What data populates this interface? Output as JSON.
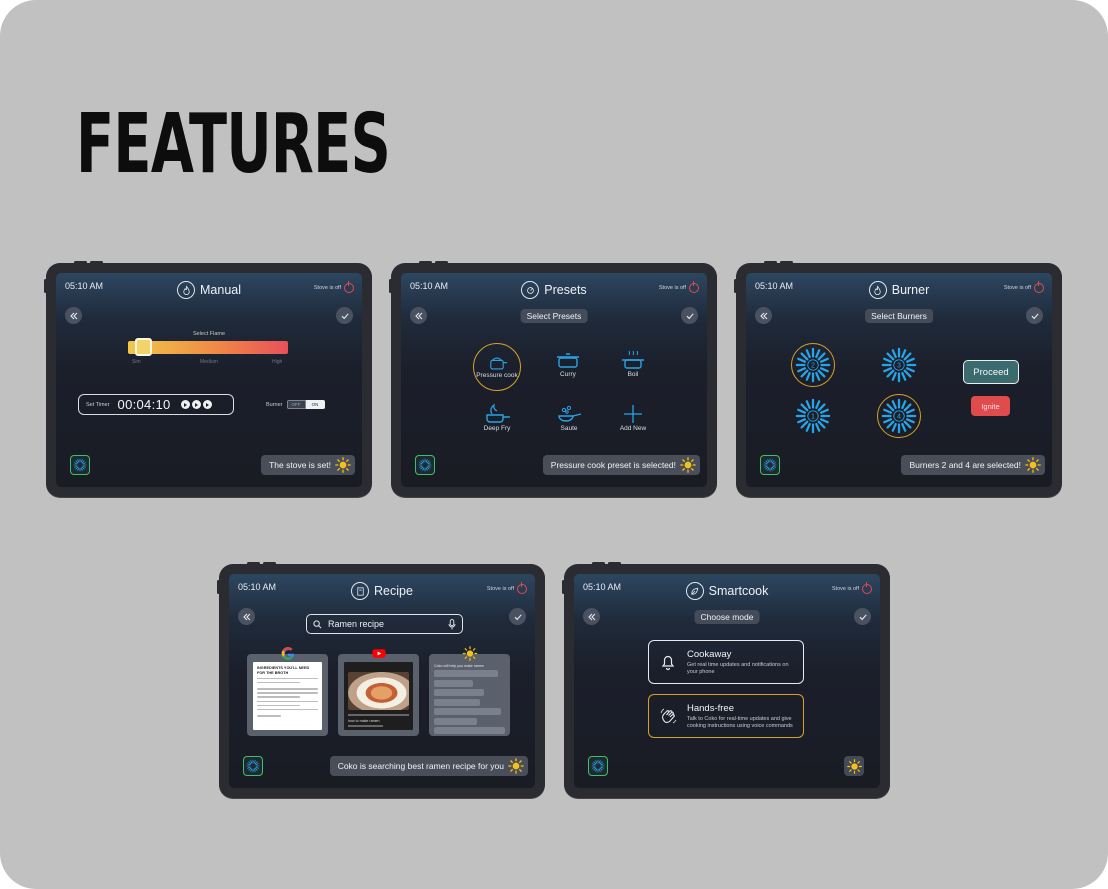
{
  "page": {
    "headline": "FEATURES"
  },
  "colors": {
    "background": "#c1c1c1",
    "accent_gold": "#d6a12b",
    "power_red": "#e14a4a",
    "burner_blue": "#2aa3e6",
    "chip_green": "#3fbf6a",
    "proceed_teal": "#3b6b6e",
    "ignite_red": "#e04b4b"
  },
  "common": {
    "time": "05:10 AM",
    "stove_status": "Stove is off"
  },
  "manual": {
    "title": "Manual",
    "select_flame": "Select Flame",
    "flame_level": 0.05,
    "scale": [
      "Sim",
      "Medium",
      "High"
    ],
    "timer_label": "Set Timer",
    "timer_value": "00:04:10",
    "burner_label": "Burner",
    "toggle_off": "OFF",
    "toggle_on": "ON",
    "toast": "The stove is set!"
  },
  "presets": {
    "title": "Presets",
    "pill": "Select Presets",
    "items": [
      {
        "label": "Pressure cook",
        "icon": "pressure-cooker-icon",
        "selected": true
      },
      {
        "label": "Curry",
        "icon": "pot-icon"
      },
      {
        "label": "Boil",
        "icon": "boiling-pot-icon"
      },
      {
        "label": "Deep Fry",
        "icon": "deep-fry-icon"
      },
      {
        "label": "Saute",
        "icon": "saute-pan-icon"
      },
      {
        "label": "Add New",
        "icon": "plus-icon"
      }
    ],
    "toast": "Pressure cook preset is selected!"
  },
  "burner": {
    "title": "Burner",
    "pill": "Select Burners",
    "burners": [
      {
        "number": "2",
        "selected": true
      },
      {
        "number": "3",
        "selected": false
      },
      {
        "number": "1",
        "selected": false
      },
      {
        "number": "4",
        "selected": true
      }
    ],
    "proceed": "Proceed",
    "ignite": "Ignite",
    "toast": "Burners 2 and 4 are selected!"
  },
  "recipe": {
    "title": "Recipe",
    "search_value": "Ramen recipe",
    "article_heading": "INGREDIENTS YOU'LL NEED FOR THE BROTH",
    "video_caption": "how to make ramen",
    "chat_intro": "Coko will help you make ramen",
    "toast": "Coko is searching best ramen recipe for you"
  },
  "smartcook": {
    "title": "Smartcook",
    "pill": "Choose mode",
    "modes": [
      {
        "title": "Cookaway",
        "desc": "Get real time updates and notifications on your phone",
        "icon": "bell-icon"
      },
      {
        "title": "Hands-free",
        "desc": "Talk to Coko for real-time updates and give cooking instructions using voice commands",
        "icon": "wave-hand-icon"
      }
    ]
  }
}
